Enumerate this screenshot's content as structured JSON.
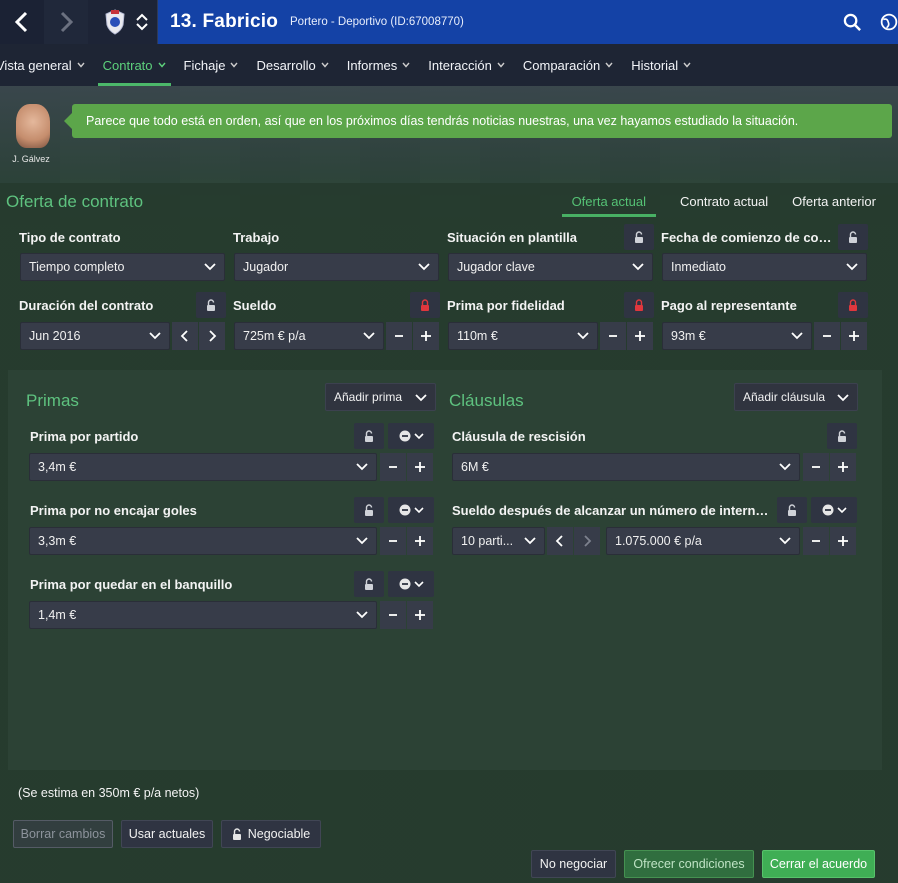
{
  "colors": {
    "accent_green": "#5ec27f",
    "topbar_blue": "#1442a6",
    "lock_red": "#e0373d"
  },
  "topbar": {
    "player_title": "13. Fabricio",
    "player_subtitle": "Portero - Deportivo (ID:67008770)",
    "icons": [
      "back-icon",
      "forward-icon",
      "club-crest-icon",
      "up-down-icon",
      "search-icon",
      "globe-icon"
    ]
  },
  "menu": [
    {
      "label": "Vista general",
      "active": false
    },
    {
      "label": "Contrato",
      "active": true
    },
    {
      "label": "Fichaje",
      "active": false
    },
    {
      "label": "Desarrollo",
      "active": false
    },
    {
      "label": "Informes",
      "active": false
    },
    {
      "label": "Interacción",
      "active": false
    },
    {
      "label": "Comparación",
      "active": false
    },
    {
      "label": "Historial",
      "active": false
    }
  ],
  "staff": {
    "name": "J. Gálvez",
    "message": "Parece que todo está en orden, así que en los próximos días tendrás noticias nuestras, una vez hayamos estudiado la situación."
  },
  "offer": {
    "title": "Oferta de contrato",
    "tabs": [
      "Oferta actual",
      "Contrato actual",
      "Oferta anterior"
    ],
    "active_tab": "Oferta actual",
    "fields": {
      "tipo": {
        "label": "Tipo de contrato",
        "value": "Tiempo completo"
      },
      "trabajo": {
        "label": "Trabajo",
        "value": "Jugador"
      },
      "situacion": {
        "label": "Situación en plantilla",
        "value": "Jugador clave",
        "locked": false
      },
      "fecha": {
        "label": "Fecha de comienzo de cont...",
        "value": "Inmediato",
        "locked": false
      },
      "duracion": {
        "label": "Duración del contrato",
        "value": "Jun 2016",
        "locked": false
      },
      "sueldo": {
        "label": "Sueldo",
        "value": "725m € p/a",
        "locked": true
      },
      "fidelidad": {
        "label": "Prima por fidelidad",
        "value": "110m €",
        "locked": true
      },
      "representante": {
        "label": "Pago al representante",
        "value": "93m €",
        "locked": true
      }
    }
  },
  "primas": {
    "title": "Primas",
    "add_label": "Añadir prima",
    "items": [
      {
        "label": "Prima por partido",
        "value": "3,4m €"
      },
      {
        "label": "Prima por no encajar goles",
        "value": "3,3m €"
      },
      {
        "label": "Prima por quedar en el banquillo",
        "value": "1,4m €"
      }
    ]
  },
  "clausulas": {
    "title": "Cláusulas",
    "add_label": "Añadir cláusula",
    "rescision": {
      "label": "Cláusula de rescisión",
      "value": "6M €"
    },
    "sueldo_internacional": {
      "label": "Sueldo después de alcanzar un número de internacio...",
      "partidos": "10 parti...",
      "value": "1.075.000 € p/a"
    }
  },
  "estimate": "(Se estima en 350m € p/a netos)",
  "buttons": {
    "borrar": "Borrar cambios",
    "usar": "Usar actuales",
    "negociable": "Negociable",
    "no_negociar": "No negociar",
    "ofrecer": "Ofrecer condiciones",
    "cerrar": "Cerrar el acuerdo"
  }
}
